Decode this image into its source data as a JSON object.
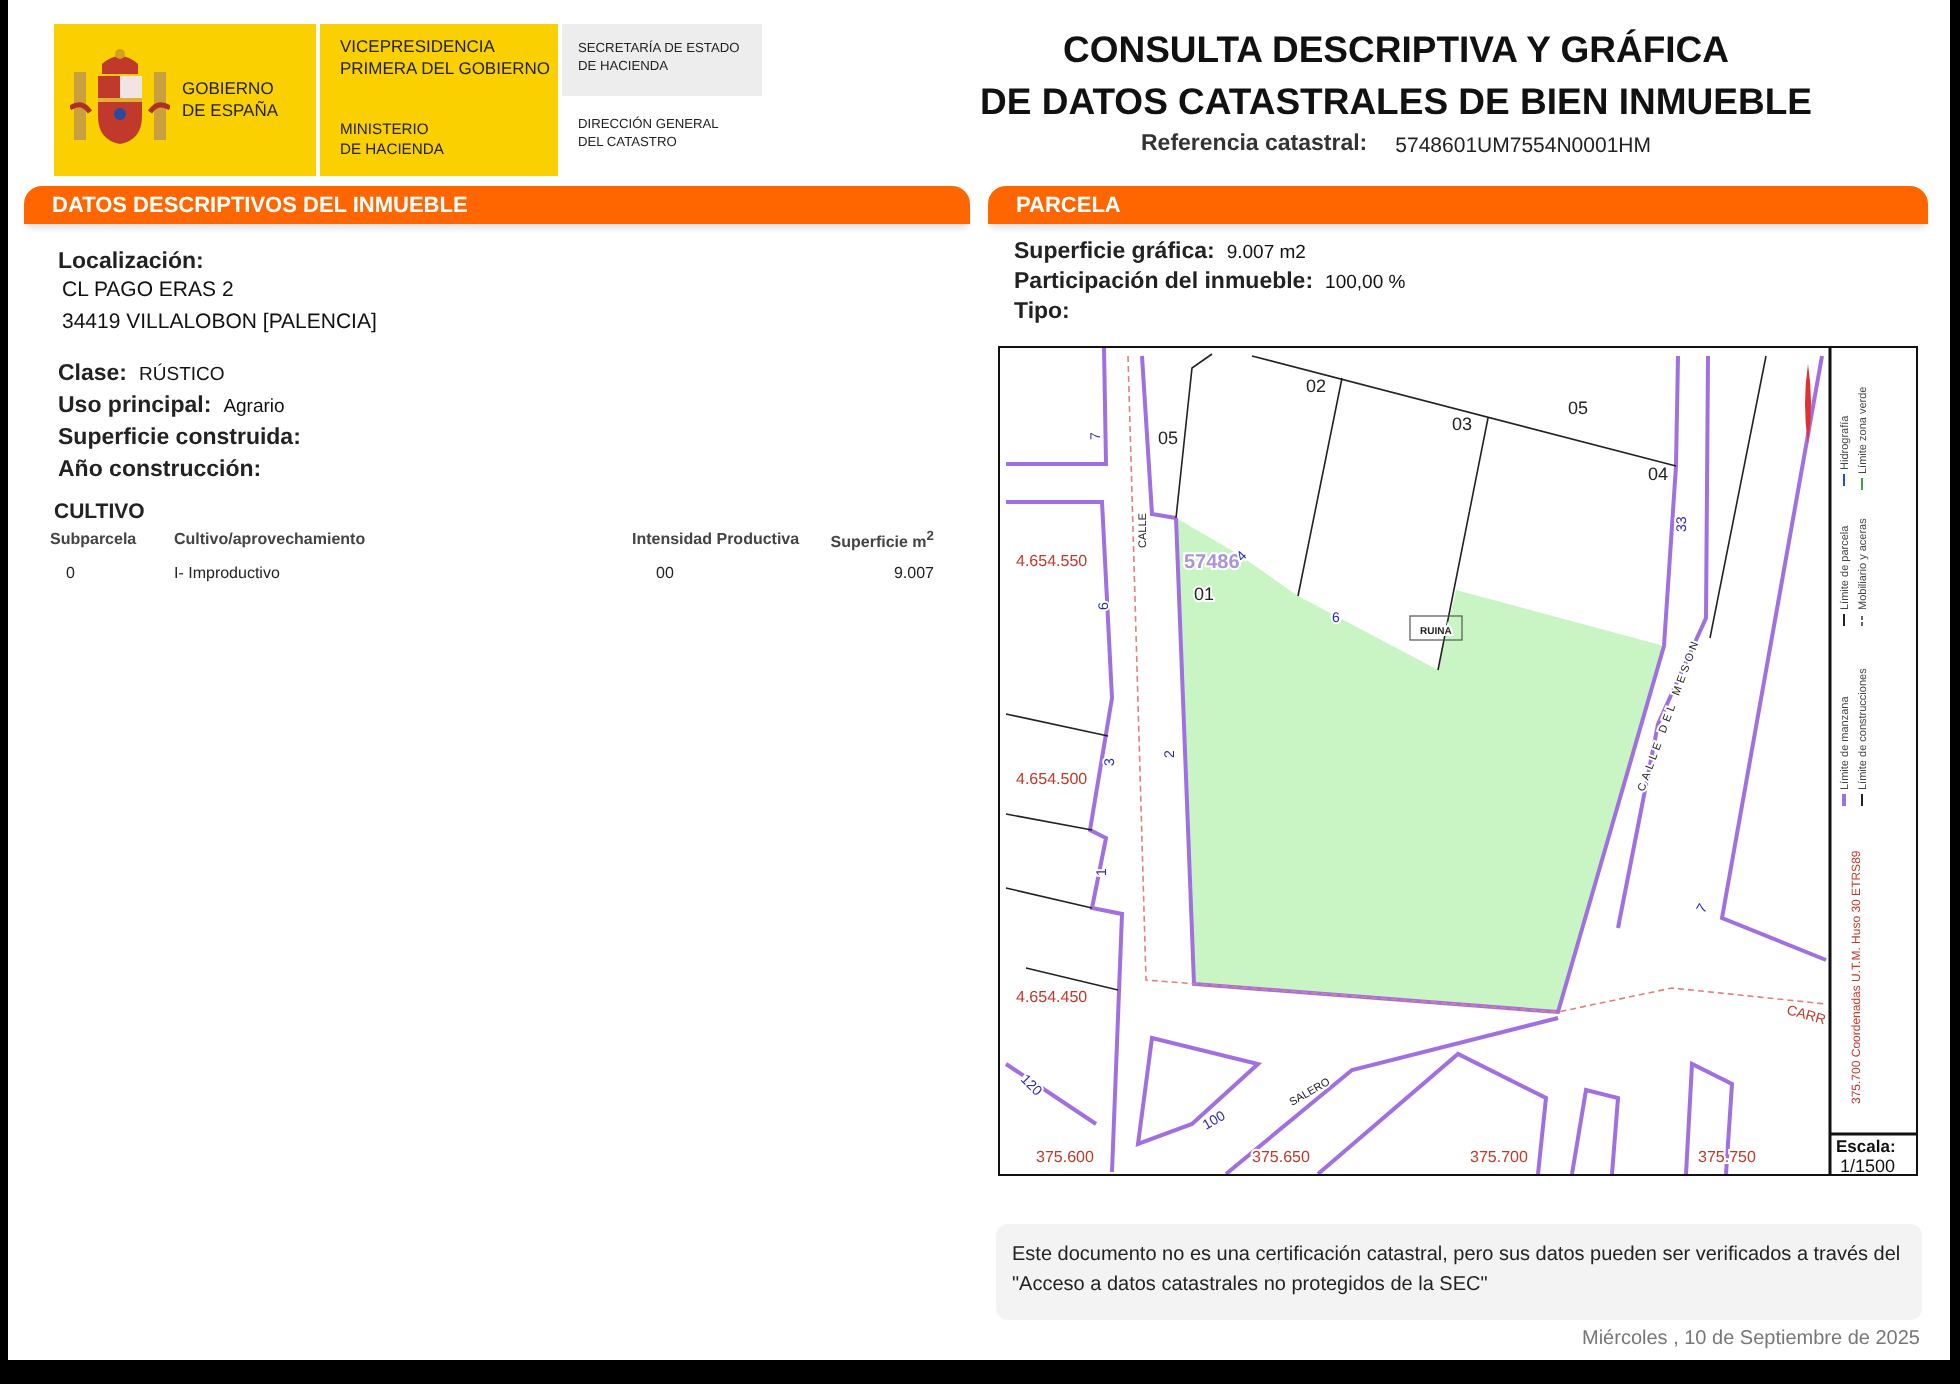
{
  "header": {
    "government": [
      "GOBIERNO",
      "DE ESPAÑA"
    ],
    "vicepresidency": [
      "VICEPRESIDENCIA",
      "PRIMERA DEL GOBIERNO"
    ],
    "ministry": [
      "MINISTERIO",
      "DE HACIENDA"
    ],
    "secretariat": [
      "SECRETARÍA DE ESTADO",
      "DE HACIENDA"
    ],
    "directorate": [
      "DIRECCIÓN GENERAL",
      "DEL CATASTRO"
    ]
  },
  "title": [
    "CONSULTA DESCRIPTIVA Y GRÁFICA",
    "DE DATOS CATASTRALES DE BIEN INMUEBLE"
  ],
  "reference": {
    "label": "Referencia catastral:",
    "value": "5748601UM7554N0001HM"
  },
  "description": {
    "title": "DATOS DESCRIPTIVOS DEL INMUEBLE",
    "location": {
      "label": "Localización:",
      "lines": [
        "CL PAGO ERAS 2",
        "34419 VILLALOBON [PALENCIA]"
      ]
    },
    "fields": [
      {
        "label": "Clase:",
        "value": "RÚSTICO"
      },
      {
        "label": "Uso principal:",
        "value": "Agrario"
      },
      {
        "label": "Superficie construida:"
      },
      {
        "label": "Año construcción:"
      }
    ],
    "cultivation": {
      "title": "CULTIVO",
      "columns": [
        "Subparcela",
        "Cultivo/aprovechamiento",
        "Intensidad Productiva",
        "Superficie m$^{2}$"
      ],
      "rows": [
        [
          "0",
          "I- Improductivo",
          "00",
          "9.007"
        ]
      ]
    }
  },
  "parcel": {
    "title": "PARCELA",
    "fields": [
      {
        "label": "Superficie gráfica:",
        "value": "9.007 m2"
      },
      {
        "label": "Participación del inmueble:",
        "value": "100,00 %"
      },
      {
        "label": "Tipo:"
      }
    ],
    "map": {
      "labels": [
        {
          "text": "02",
          "kind": "subparcel"
        },
        {
          "text": "05",
          "kind": "subparcel"
        },
        {
          "text": "03",
          "kind": "subparcel"
        },
        {
          "text": "05",
          "kind": "subparcel"
        },
        {
          "text": "04",
          "kind": "subparcel"
        },
        {
          "text": "01",
          "kind": "subparcel"
        },
        {
          "text": "57486",
          "kind": "parcel"
        },
        {
          "text": "CALLE",
          "kind": "street"
        },
        {
          "text": "RUINA",
          "kind": "building"
        },
        {
          "text": "CALLE DEL MESON",
          "kind": "street"
        },
        {
          "text": "CARR",
          "kind": "road"
        },
        {
          "text": "SALERO",
          "kind": "street"
        },
        {
          "text": "120",
          "kind": "number"
        },
        {
          "text": "100",
          "kind": "number"
        },
        {
          "text": "7",
          "kind": "number"
        },
        {
          "text": "6",
          "kind": "number"
        },
        {
          "text": "4",
          "kind": "number"
        },
        {
          "text": "6",
          "kind": "number"
        },
        {
          "text": "2",
          "kind": "number"
        },
        {
          "text": "3",
          "kind": "number"
        },
        {
          "text": "1",
          "kind": "number"
        },
        {
          "text": "33",
          "kind": "number"
        },
        {
          "text": "7",
          "kind": "number"
        },
        {
          "text": "4.654.550",
          "kind": "coordinate"
        },
        {
          "text": "4.654.500",
          "kind": "coordinate"
        },
        {
          "text": "4.654.450",
          "kind": "coordinate"
        },
        {
          "text": "375.600",
          "kind": "coordinate"
        },
        {
          "text": "375.650",
          "kind": "coordinate"
        },
        {
          "text": "375.700",
          "kind": "coordinate"
        },
        {
          "text": "375.750",
          "kind": "coordinate"
        }
      ],
      "legend": [
        {
          "text": "Límite de manzana",
          "kind": "block"
        },
        {
          "text": "Límite de parcela",
          "kind": "parcel"
        },
        {
          "text": "Hidrografía",
          "kind": "water"
        },
        {
          "text": "Límite de construcciones",
          "kind": "building"
        },
        {
          "text": "Mobiliario y aceras",
          "kind": "furniture"
        },
        {
          "text": "Límite zona verde",
          "kind": "green"
        }
      ],
      "coordinate_note": "375.700 Coordenadas U.T.M. Huso 30 ETRS89",
      "scale": {
        "label": "Escala:",
        "value": "1/1500"
      }
    }
  },
  "notice": "Este documento no es una certificación catastral, pero sus datos pueden ser verificados a través del \"Acceso a datos catastrales no protegidos de la SEC\"",
  "date": "Miércoles , 10 de Septiembre de 2025"
}
